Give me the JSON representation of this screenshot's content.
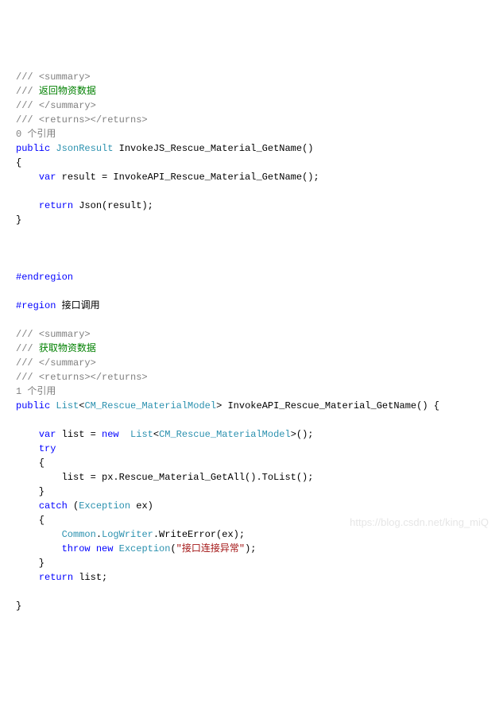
{
  "code": {
    "line01_a": "/// ",
    "line01_b": "<summary>",
    "line02_a": "/// ",
    "line02_b": "返回物资数据",
    "line03_a": "/// ",
    "line03_b": "</summary>",
    "line04_a": "/// ",
    "line04_b": "<returns></returns>",
    "line05": "0 个引用",
    "line06_a": "public",
    "line06_b": " ",
    "line06_c": "JsonResult",
    "line06_d": " InvokeJS_Rescue_Material_GetName()",
    "line07": "{",
    "line08_a": "    ",
    "line08_b": "var",
    "line08_c": " result = InvokeAPI_Rescue_Material_GetName();",
    "line09": "",
    "line10_a": "    ",
    "line10_b": "return",
    "line10_c": " Json(result);",
    "line11": "}",
    "line12": "",
    "line13": "",
    "line14": "",
    "line15_a": "#endregion",
    "line16": "",
    "line17_a": "#region",
    "line17_b": " 接口调用",
    "line18": "",
    "line19_a": "/// ",
    "line19_b": "<summary>",
    "line20_a": "/// ",
    "line20_b": "获取物资数据",
    "line21_a": "/// ",
    "line21_b": "</summary>",
    "line22_a": "/// ",
    "line22_b": "<returns></returns>",
    "line23": "1 个引用",
    "line24_a": "public",
    "line24_b": " ",
    "line24_c": "List",
    "line24_d": "<",
    "line24_e": "CM_Rescue_MaterialModel",
    "line24_f": "> InvokeAPI_Rescue_Material_GetName() {",
    "line25": "",
    "line26_a": "    ",
    "line26_b": "var",
    "line26_c": " list = ",
    "line26_d": "new",
    "line26_e": "  ",
    "line26_f": "List",
    "line26_g": "<",
    "line26_h": "CM_Rescue_MaterialModel",
    "line26_i": ">();",
    "line27_a": "    ",
    "line27_b": "try",
    "line28": "    {",
    "line29": "        list = px.Rescue_Material_GetAll().ToList();",
    "line30": "    }",
    "line31_a": "    ",
    "line31_b": "catch",
    "line31_c": " (",
    "line31_d": "Exception",
    "line31_e": " ex)",
    "line32": "    {",
    "line33_a": "        ",
    "line33_b": "Common",
    "line33_c": ".",
    "line33_d": "LogWriter",
    "line33_e": ".WriteError(ex);",
    "line34_a": "        ",
    "line34_b": "throw",
    "line34_c": " ",
    "line34_d": "new",
    "line34_e": " ",
    "line34_f": "Exception",
    "line34_g": "(",
    "line34_h": "\"接口连接异常\"",
    "line34_i": ");",
    "line35": "    }",
    "line36_a": "    ",
    "line36_b": "return",
    "line36_c": " list;",
    "line37": "",
    "line38": "}"
  },
  "watermark": "https://blog.csdn.net/king_miQ"
}
